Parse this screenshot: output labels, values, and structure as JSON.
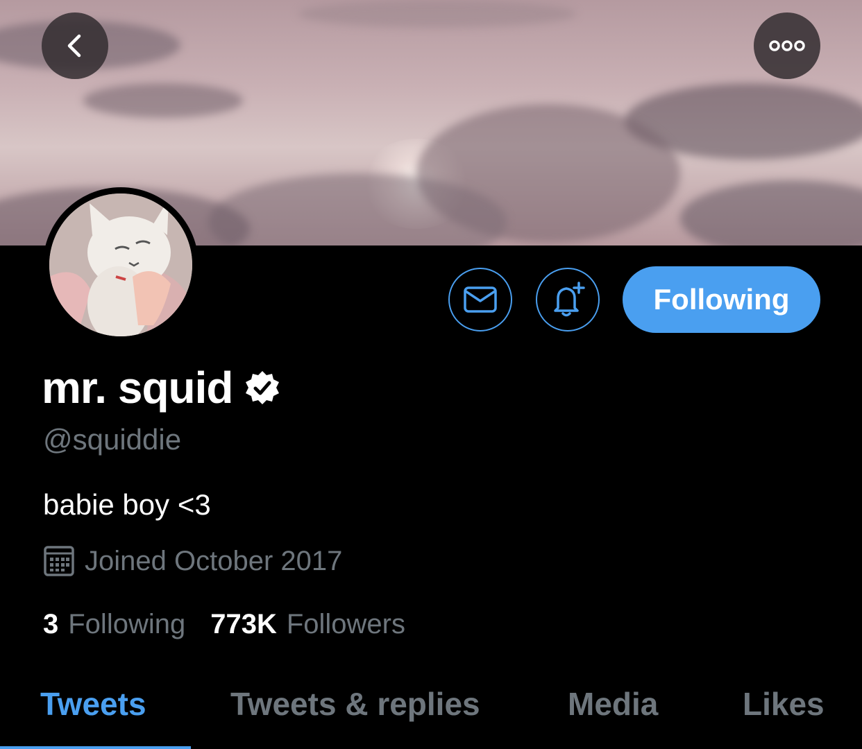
{
  "header": {
    "back_icon": "chevron-left-icon",
    "more_icon": "more-horizontal-icon"
  },
  "profile": {
    "display_name": "mr. squid",
    "handle": "@squiddie",
    "bio": "babie boy <3",
    "joined": "Joined October 2017",
    "verified": true
  },
  "actions": {
    "message_icon": "envelope-icon",
    "notify_icon": "bell-plus-icon",
    "follow_label": "Following"
  },
  "stats": {
    "following_count": "3",
    "following_label": "Following",
    "followers_count": "773K",
    "followers_label": "Followers"
  },
  "tabs": [
    {
      "label": "Tweets",
      "active": true
    },
    {
      "label": "Tweets & replies",
      "active": false
    },
    {
      "label": "Media",
      "active": false
    },
    {
      "label": "Likes",
      "active": false
    }
  ],
  "colors": {
    "accent": "#4a9ff0",
    "muted_text": "#6e767d",
    "background": "#000000"
  }
}
